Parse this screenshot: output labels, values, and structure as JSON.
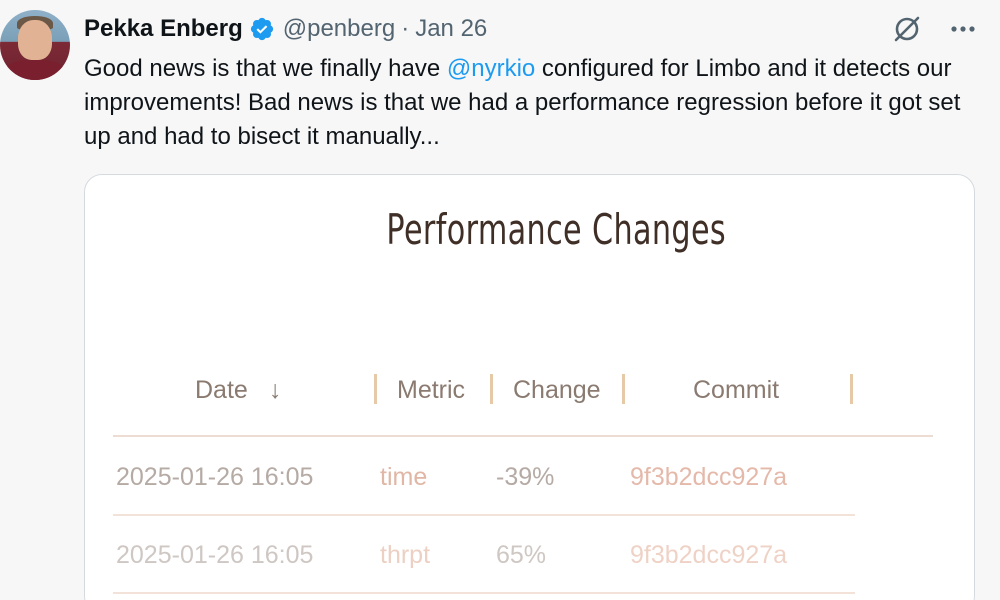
{
  "tweet": {
    "author_name": "Pekka Enberg",
    "handle": "@penberg",
    "separator": "·",
    "date": "Jan 26",
    "text_before": "Good news is that we finally have ",
    "mention": "@nyrkio",
    "text_after": " configured for Limbo and it detects our improvements! Bad news is that we had a performance regression before it got set up and had to bisect it manually...",
    "accent_color": "#1d9bf0"
  },
  "card": {
    "title": "Performance Changes",
    "columns": {
      "date": "Date",
      "sort_icon": "↓",
      "metric": "Metric",
      "change": "Change",
      "commit": "Commit"
    },
    "rows": [
      {
        "date": "2025-01-26 16:05",
        "metric": "time",
        "change": "-39%",
        "commit": "9f3b2dcc927a"
      },
      {
        "date": "2025-01-26 16:05",
        "metric": "thrpt",
        "change": "65%",
        "commit": "9f3b2dcc927a"
      }
    ]
  },
  "icons": {
    "verified": "verified-badge-icon",
    "grok": "grok-icon",
    "more": "more-icon",
    "sort": "arrow-down-icon"
  }
}
